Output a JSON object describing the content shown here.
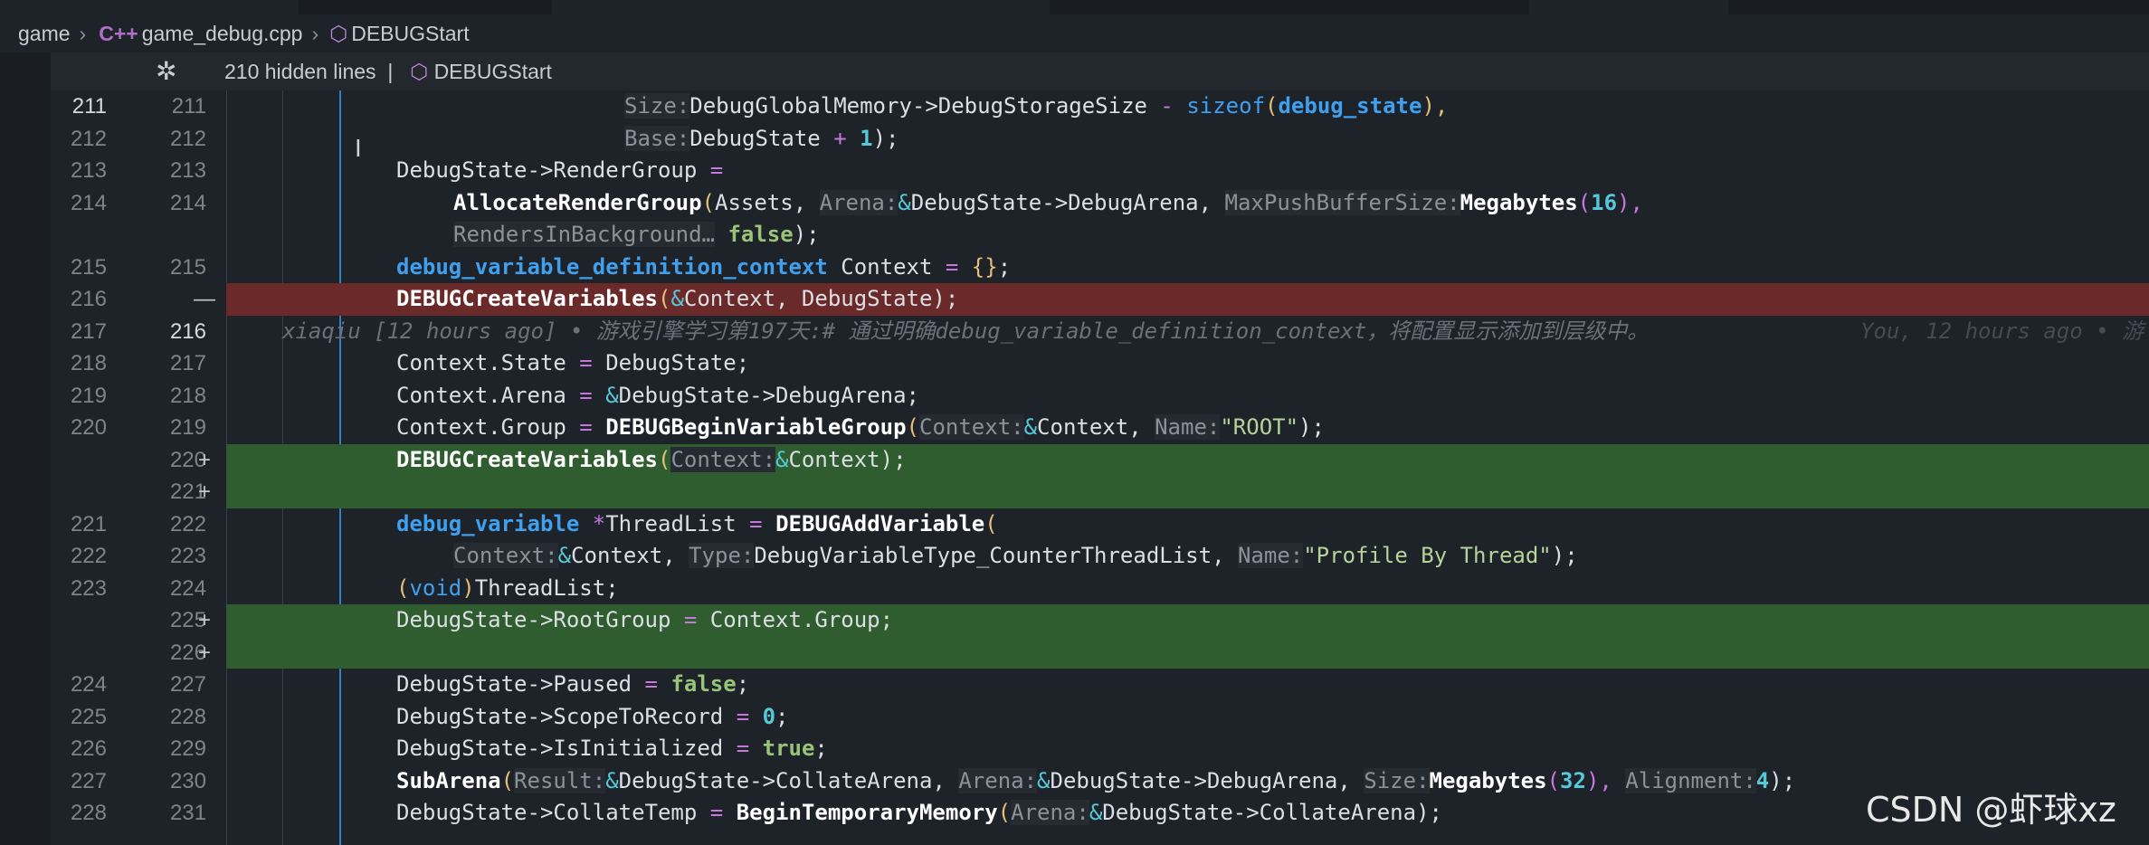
{
  "breadcrumb": {
    "folder": "game",
    "file": "game_debug.cpp",
    "symbol": "DEBUGStart",
    "file_icon": "c-plus-plus-icon",
    "symbol_icon": "cube-icon"
  },
  "fold_bar": {
    "hidden_lines": "210 hidden lines",
    "separator": "|",
    "symbol": "DEBUGStart"
  },
  "colors": {
    "deleted_line_bg": "#6b2a2a",
    "added_line_bg": "#2f5d2f",
    "editor_bg": "#1e2229",
    "accent_blue": "#3fa0ef"
  },
  "lines": [
    {
      "old": "211",
      "new": "211",
      "current": true,
      "diff": ""
    },
    {
      "old": "212",
      "new": "212",
      "current": false,
      "diff": ""
    },
    {
      "old": "213",
      "new": "213",
      "current": false,
      "diff": ""
    },
    {
      "old": "214",
      "new": "214",
      "current": false,
      "diff": ""
    },
    {
      "old": "",
      "new": "",
      "current": false,
      "diff": ""
    },
    {
      "old": "215",
      "new": "215",
      "current": false,
      "diff": ""
    },
    {
      "old": "216",
      "new": "",
      "mark": "—",
      "current": false,
      "diff": "del"
    },
    {
      "old": "217",
      "new": "216",
      "current": true,
      "diff": "",
      "blame": "xiaqiu [12 hours ago] • 游戏引擎学习第197天:# 通过明确debug_variable_definition_context，将配置显示添加到层级中。",
      "blame_right": "You, 12 hours ago • 游"
    },
    {
      "old": "218",
      "new": "217",
      "current": false,
      "diff": ""
    },
    {
      "old": "219",
      "new": "218",
      "current": false,
      "diff": ""
    },
    {
      "old": "220",
      "new": "219",
      "current": false,
      "diff": ""
    },
    {
      "old": "",
      "new": "220",
      "mark": "+",
      "current": false,
      "diff": "add"
    },
    {
      "old": "",
      "new": "221",
      "mark": "+",
      "current": false,
      "diff": "add"
    },
    {
      "old": "221",
      "new": "222",
      "current": false,
      "diff": ""
    },
    {
      "old": "222",
      "new": "223",
      "current": false,
      "diff": ""
    },
    {
      "old": "223",
      "new": "224",
      "current": false,
      "diff": ""
    },
    {
      "old": "",
      "new": "225",
      "mark": "+",
      "current": false,
      "diff": "add"
    },
    {
      "old": "",
      "new": "226",
      "mark": "+",
      "current": false,
      "diff": "add"
    },
    {
      "old": "224",
      "new": "227",
      "current": false,
      "diff": ""
    },
    {
      "old": "225",
      "new": "228",
      "current": false,
      "diff": ""
    },
    {
      "old": "226",
      "new": "229",
      "current": false,
      "diff": ""
    },
    {
      "old": "227",
      "new": "230",
      "current": false,
      "diff": ""
    },
    {
      "old": "228",
      "new": "231",
      "current": false,
      "diff": ""
    }
  ],
  "code": {
    "l0": {
      "hint1": "Size:",
      "a": "DebugGlobalMemory->DebugStorageSize ",
      "op": "-",
      "b": " ",
      "kw": "sizeof",
      "p1": "(",
      "type": "debug_state",
      "p2": "),"
    },
    "l1": {
      "hint1": "Base:",
      "a": "DebugState ",
      "op": "+",
      "b": " ",
      "num": "1",
      "c": ");"
    },
    "l2": {
      "a": "DebugState->RenderGroup ",
      "op": "="
    },
    "l3": {
      "fn": "AllocateRenderGroup",
      "p1": "(",
      "a": "Assets, ",
      "hint1": "Arena:",
      "amp": "&",
      "b": "DebugState->DebugArena, ",
      "hint2": "MaxPushBufferSize:",
      "fn2": "Megabytes",
      "p2": "(",
      "num": "16",
      "p3": "),"
    },
    "l4": {
      "hint1": "RendersInBackground…",
      "bool": "false",
      "c": ");"
    },
    "l5": {
      "type": "debug_variable_definition_context",
      "a": " Context ",
      "op": "=",
      "b": " ",
      "brace": "{}",
      "c": ";"
    },
    "l6": {
      "fn": "DEBUGCreateVariables",
      "p1": "(",
      "amp": "&",
      "a": "Context, DebugState);"
    },
    "l8": {
      "a": "Context.State ",
      "op": "=",
      "b": " DebugState;"
    },
    "l9": {
      "a": "Context.Arena ",
      "op": "=",
      "b": " ",
      "amp": "&",
      "c": "DebugState->DebugArena;"
    },
    "l10": {
      "a": "Context.Group ",
      "op": "=",
      "b": " ",
      "fn": "DEBUGBeginVariableGroup",
      "p1": "(",
      "hint1": "Context:",
      "amp": "&",
      "c": "Context, ",
      "hint2": "Name:",
      "str": "\"ROOT\"",
      "d": ");"
    },
    "l11": {
      "fn": "DEBUGCreateVariables",
      "p1": "(",
      "hint1": "Context:",
      "amp": "&",
      "a": "Context);"
    },
    "l13": {
      "type": "debug_variable",
      "a": " ",
      "op": "*",
      "b": "ThreadList ",
      "op2": "=",
      "c": " ",
      "fn": "DEBUGAddVariable",
      "p1": "("
    },
    "l14": {
      "hint1": "Context:",
      "amp": "&",
      "a": "Context, ",
      "hint2": "Type:",
      "b": "DebugVariableType_CounterThreadList, ",
      "hint3": "Name:",
      "str": "\"Profile By Thread\"",
      "c": ");"
    },
    "l15": {
      "p1": "(",
      "kw": "void",
      "p2": ")",
      "a": "ThreadList;"
    },
    "l16": {
      "a": "DebugState->RootGroup ",
      "op": "=",
      "b": " Context.Group;"
    },
    "l18": {
      "a": "DebugState->Paused ",
      "op": "=",
      "b": " ",
      "bool": "false",
      "c": ";"
    },
    "l19": {
      "a": "DebugState->ScopeToRecord ",
      "op": "=",
      "b": " ",
      "num": "0",
      "c": ";"
    },
    "l20": {
      "a": "DebugState->IsInitialized ",
      "op": "=",
      "b": " ",
      "bool": "true",
      "c": ";"
    },
    "l21": {
      "fn": "SubArena",
      "p1": "(",
      "hint1": "Result:",
      "amp": "&",
      "a": "DebugState->CollateArena, ",
      "hint2": "Arena:",
      "amp2": "&",
      "b": "DebugState->DebugArena, ",
      "hint3": "Size:",
      "fn2": "Megabytes",
      "p2": "(",
      "num": "32",
      "p3": "),",
      "c": " ",
      "hint4": "Alignment:",
      "num2": "4",
      "d": ");"
    },
    "l22": {
      "a": "DebugState->CollateTemp ",
      "op": "=",
      "b": " ",
      "fn": "BeginTemporaryMemory",
      "p1": "(",
      "hint1": "Arena:",
      "amp": "&",
      "c": "DebugState->CollateArena);"
    }
  },
  "watermark": "CSDN @虾球xz"
}
